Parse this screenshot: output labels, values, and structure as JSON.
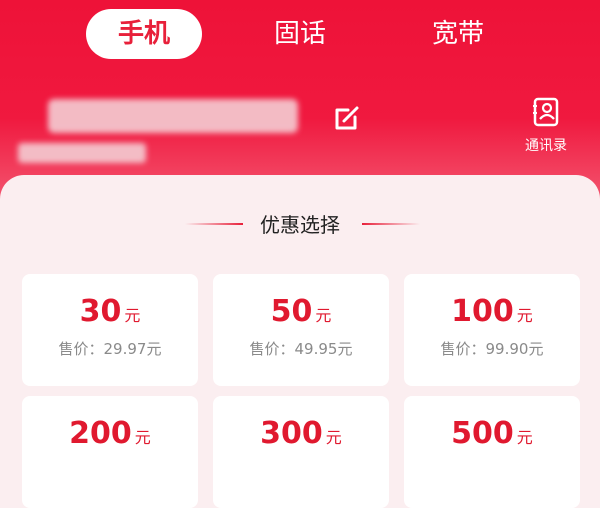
{
  "tabs": [
    {
      "label": "手机",
      "active": true
    },
    {
      "label": "固话",
      "active": false
    },
    {
      "label": "宽带",
      "active": false
    }
  ],
  "contacts": {
    "label": "通讯录",
    "icon": "contacts-book-icon"
  },
  "edit_icon": "edit-icon",
  "section": {
    "title": "优惠选择"
  },
  "products": [
    {
      "amount": "30",
      "unit": "元",
      "price": "售价：29.97元"
    },
    {
      "amount": "50",
      "unit": "元",
      "price": "售价：49.95元"
    },
    {
      "amount": "100",
      "unit": "元",
      "price": "售价：99.90元"
    },
    {
      "amount": "200",
      "unit": "元",
      "price": ""
    },
    {
      "amount": "300",
      "unit": "元",
      "price": ""
    },
    {
      "amount": "500",
      "unit": "元",
      "price": ""
    }
  ],
  "colors": {
    "brand_red": "#e8203a",
    "price_grey": "#8a8a8a",
    "panel_bg": "#fbeef0"
  }
}
